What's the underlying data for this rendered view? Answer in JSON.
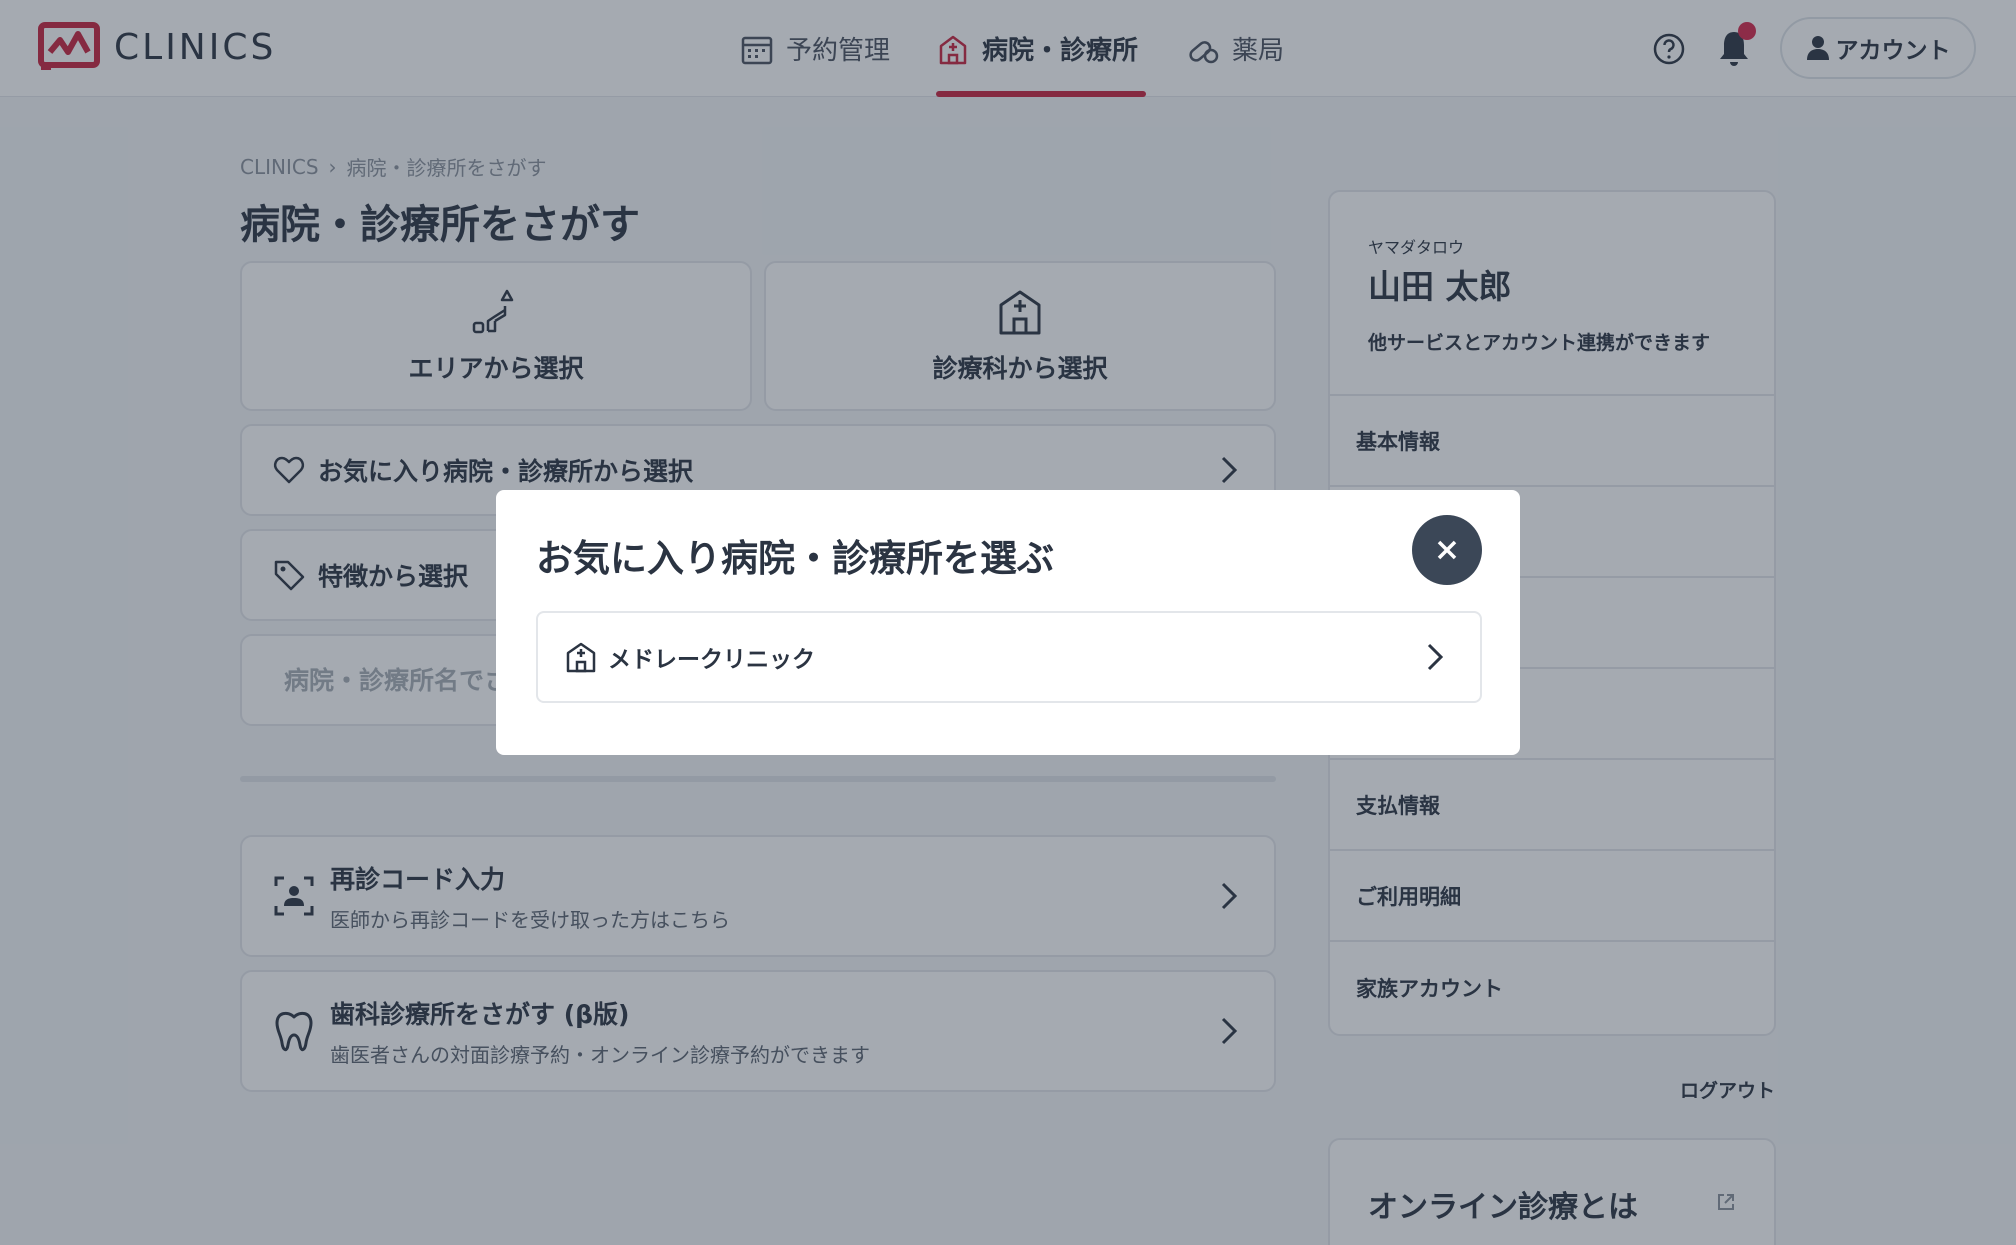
{
  "header": {
    "logo_text": "CLINICS",
    "nav": [
      {
        "label": "予約管理",
        "icon": "calendar-icon"
      },
      {
        "label": "病院・診療所",
        "icon": "hospital-icon",
        "active": true
      },
      {
        "label": "薬局",
        "icon": "pill-icon"
      }
    ],
    "account_label": "アカウント"
  },
  "breadcrumb": [
    "CLINICS",
    "病院・診療所をさがす"
  ],
  "page_title": "病院・診療所をさがす",
  "tiles": [
    {
      "label": "エリアから選択",
      "icon": "area-icon"
    },
    {
      "label": "診療科から選択",
      "icon": "hospital-icon"
    }
  ],
  "rows": {
    "favorites": "お気に入り病院・診療所から選択",
    "features": "特徴から選択"
  },
  "search": {
    "placeholder": "病院・診療所名でさがす"
  },
  "big_cards": [
    {
      "title": "再診コード入力",
      "sub": "医師から再診コードを受け取った方はこちら",
      "icon": "face-scan-icon"
    },
    {
      "title": "歯科診療所をさがす (β版)",
      "sub": "歯医者さんの対面診療予約・オンライン診療予約ができます",
      "icon": "tooth-icon"
    }
  ],
  "sidebar": {
    "kana": "ヤマダタロウ",
    "name": "山田 太郎",
    "link_note": "他サービスとアカウント連携ができます",
    "items": [
      "基本情報",
      "",
      "",
      "",
      "支払情報",
      "ご利用明細",
      "家族アカウント"
    ],
    "logout": "ログアウト",
    "online_title": "オンライン診療とは"
  },
  "modal": {
    "title": "お気に入り病院・診療所を選ぶ",
    "items": [
      "メドレークリニック"
    ]
  },
  "colors": {
    "accent": "#c8243f",
    "text": "#2b3442",
    "close_bg": "#3b4757"
  }
}
